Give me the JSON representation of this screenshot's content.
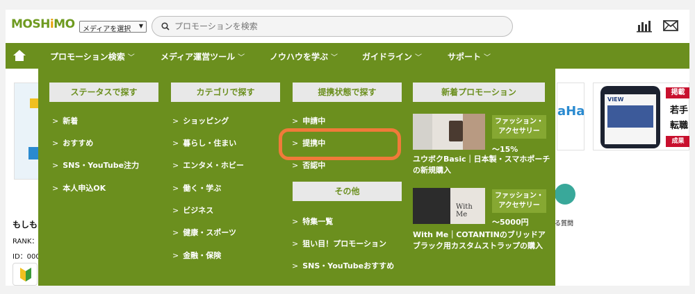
{
  "header": {
    "logo_main": "MOSH",
    "logo_hi": "i",
    "logo_end": "MO",
    "media_select": "メディアを選択",
    "search_placeholder": "プロモーションを検索"
  },
  "nav": {
    "items": [
      {
        "label": "プロモーション検索"
      },
      {
        "label": "メディア運営ツール"
      },
      {
        "label": "ノウハウを学ぶ"
      },
      {
        "label": "ガイドライン"
      },
      {
        "label": "サポート"
      }
    ]
  },
  "background": {
    "left_card_title": "もしも",
    "rank_label": "RANK：",
    "id_label": "ID：000",
    "right_banner_tag": "掲載",
    "right_banner_t1": "若手",
    "right_banner_t2": "転職",
    "right_banner_t3": "成果",
    "banner_view": "VIEW",
    "small_question": "る質問"
  },
  "mega": {
    "status": {
      "heading": "ステータスで探す",
      "items": [
        "新着",
        "おすすめ",
        "SNS・YouTube注力",
        "本人申込OK"
      ]
    },
    "category": {
      "heading": "カテゴリで探す",
      "items": [
        "ショッピング",
        "暮らし・住まい",
        "エンタメ・ホビー",
        "働く・学ぶ",
        "ビジネス",
        "健康・スポーツ",
        "金融・保険"
      ]
    },
    "partner": {
      "heading": "提携状態で探す",
      "items": [
        "申請中",
        "提携中",
        "否認中"
      ]
    },
    "other": {
      "heading": "その他",
      "items": [
        "特集一覧",
        "狙い目！プロモーション",
        "SNS・YouTubeおすすめ"
      ]
    },
    "newpromo": {
      "heading": "新着プロモーション",
      "promos": [
        {
          "badge1": "ファッション・",
          "badge2": "アクセサリー",
          "pct": "～15%",
          "title": "ユウボクBasic｜日本製・スマホポーチの新規購入"
        },
        {
          "badge1": "ファッション・",
          "badge2": "アクセサリー",
          "pct": "～5000円",
          "title": "With Me｜COTANTINのブリッドアブラック用カスタムストラップの購入",
          "img_text": "With Me"
        }
      ]
    }
  },
  "colors": {
    "brand_green": "#6b8f1e",
    "highlight": "#f07a3a"
  }
}
